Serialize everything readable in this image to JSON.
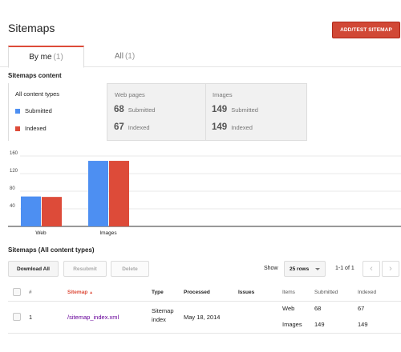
{
  "header": {
    "title": "Sitemaps",
    "add_button": "ADD/TEST SITEMAP"
  },
  "tabs": [
    {
      "label": "By me",
      "count": "(1)"
    },
    {
      "label": "All",
      "count": "(1)"
    }
  ],
  "content_section": {
    "heading": "Sitemaps content",
    "filters": [
      {
        "title": "All content types",
        "legend": [
          {
            "label": "Submitted",
            "color": "#4d8ff2"
          },
          {
            "label": "Indexed",
            "color": "#dd4b39"
          }
        ]
      },
      {
        "title": "Web pages",
        "stats": [
          {
            "value": "68",
            "label": "Submitted"
          },
          {
            "value": "67",
            "label": "Indexed"
          }
        ]
      },
      {
        "title": "Images",
        "stats": [
          {
            "value": "149",
            "label": "Submitted"
          },
          {
            "value": "149",
            "label": "Indexed"
          }
        ]
      }
    ]
  },
  "chart_data": {
    "type": "bar",
    "categories": [
      "Web",
      "Images"
    ],
    "series": [
      {
        "name": "Submitted",
        "values": [
          68,
          149
        ],
        "color": "#4d8ff2"
      },
      {
        "name": "Indexed",
        "values": [
          67,
          149
        ],
        "color": "#dd4b39"
      }
    ],
    "yticks": [
      "160",
      "120",
      "80",
      "40"
    ],
    "ylim": [
      0,
      160
    ]
  },
  "table_section": {
    "heading": "Sitemaps (All content types)",
    "buttons": {
      "download": "Download All",
      "resubmit": "Resubmit",
      "delete": "Delete"
    },
    "show_label": "Show",
    "rows_select": "25 rows",
    "range": "1-1 of 1",
    "prev": "‹",
    "next": "›",
    "columns": {
      "num": "#",
      "sitemap": "Sitemap",
      "sort_arrow": "▲",
      "type": "Type",
      "processed": "Processed",
      "issues": "Issues",
      "items": "Items",
      "submitted": "Submitted",
      "indexed": "Indexed"
    },
    "rows": [
      {
        "num": "1",
        "sitemap": "/sitemap_index.xml",
        "type_line1": "Sitemap",
        "type_line2": "index",
        "processed": "May 18, 2014",
        "items": [
          {
            "name": "Web",
            "submitted": "68",
            "indexed": "67"
          },
          {
            "name": "Images",
            "submitted": "149",
            "indexed": "149"
          }
        ]
      }
    ]
  }
}
